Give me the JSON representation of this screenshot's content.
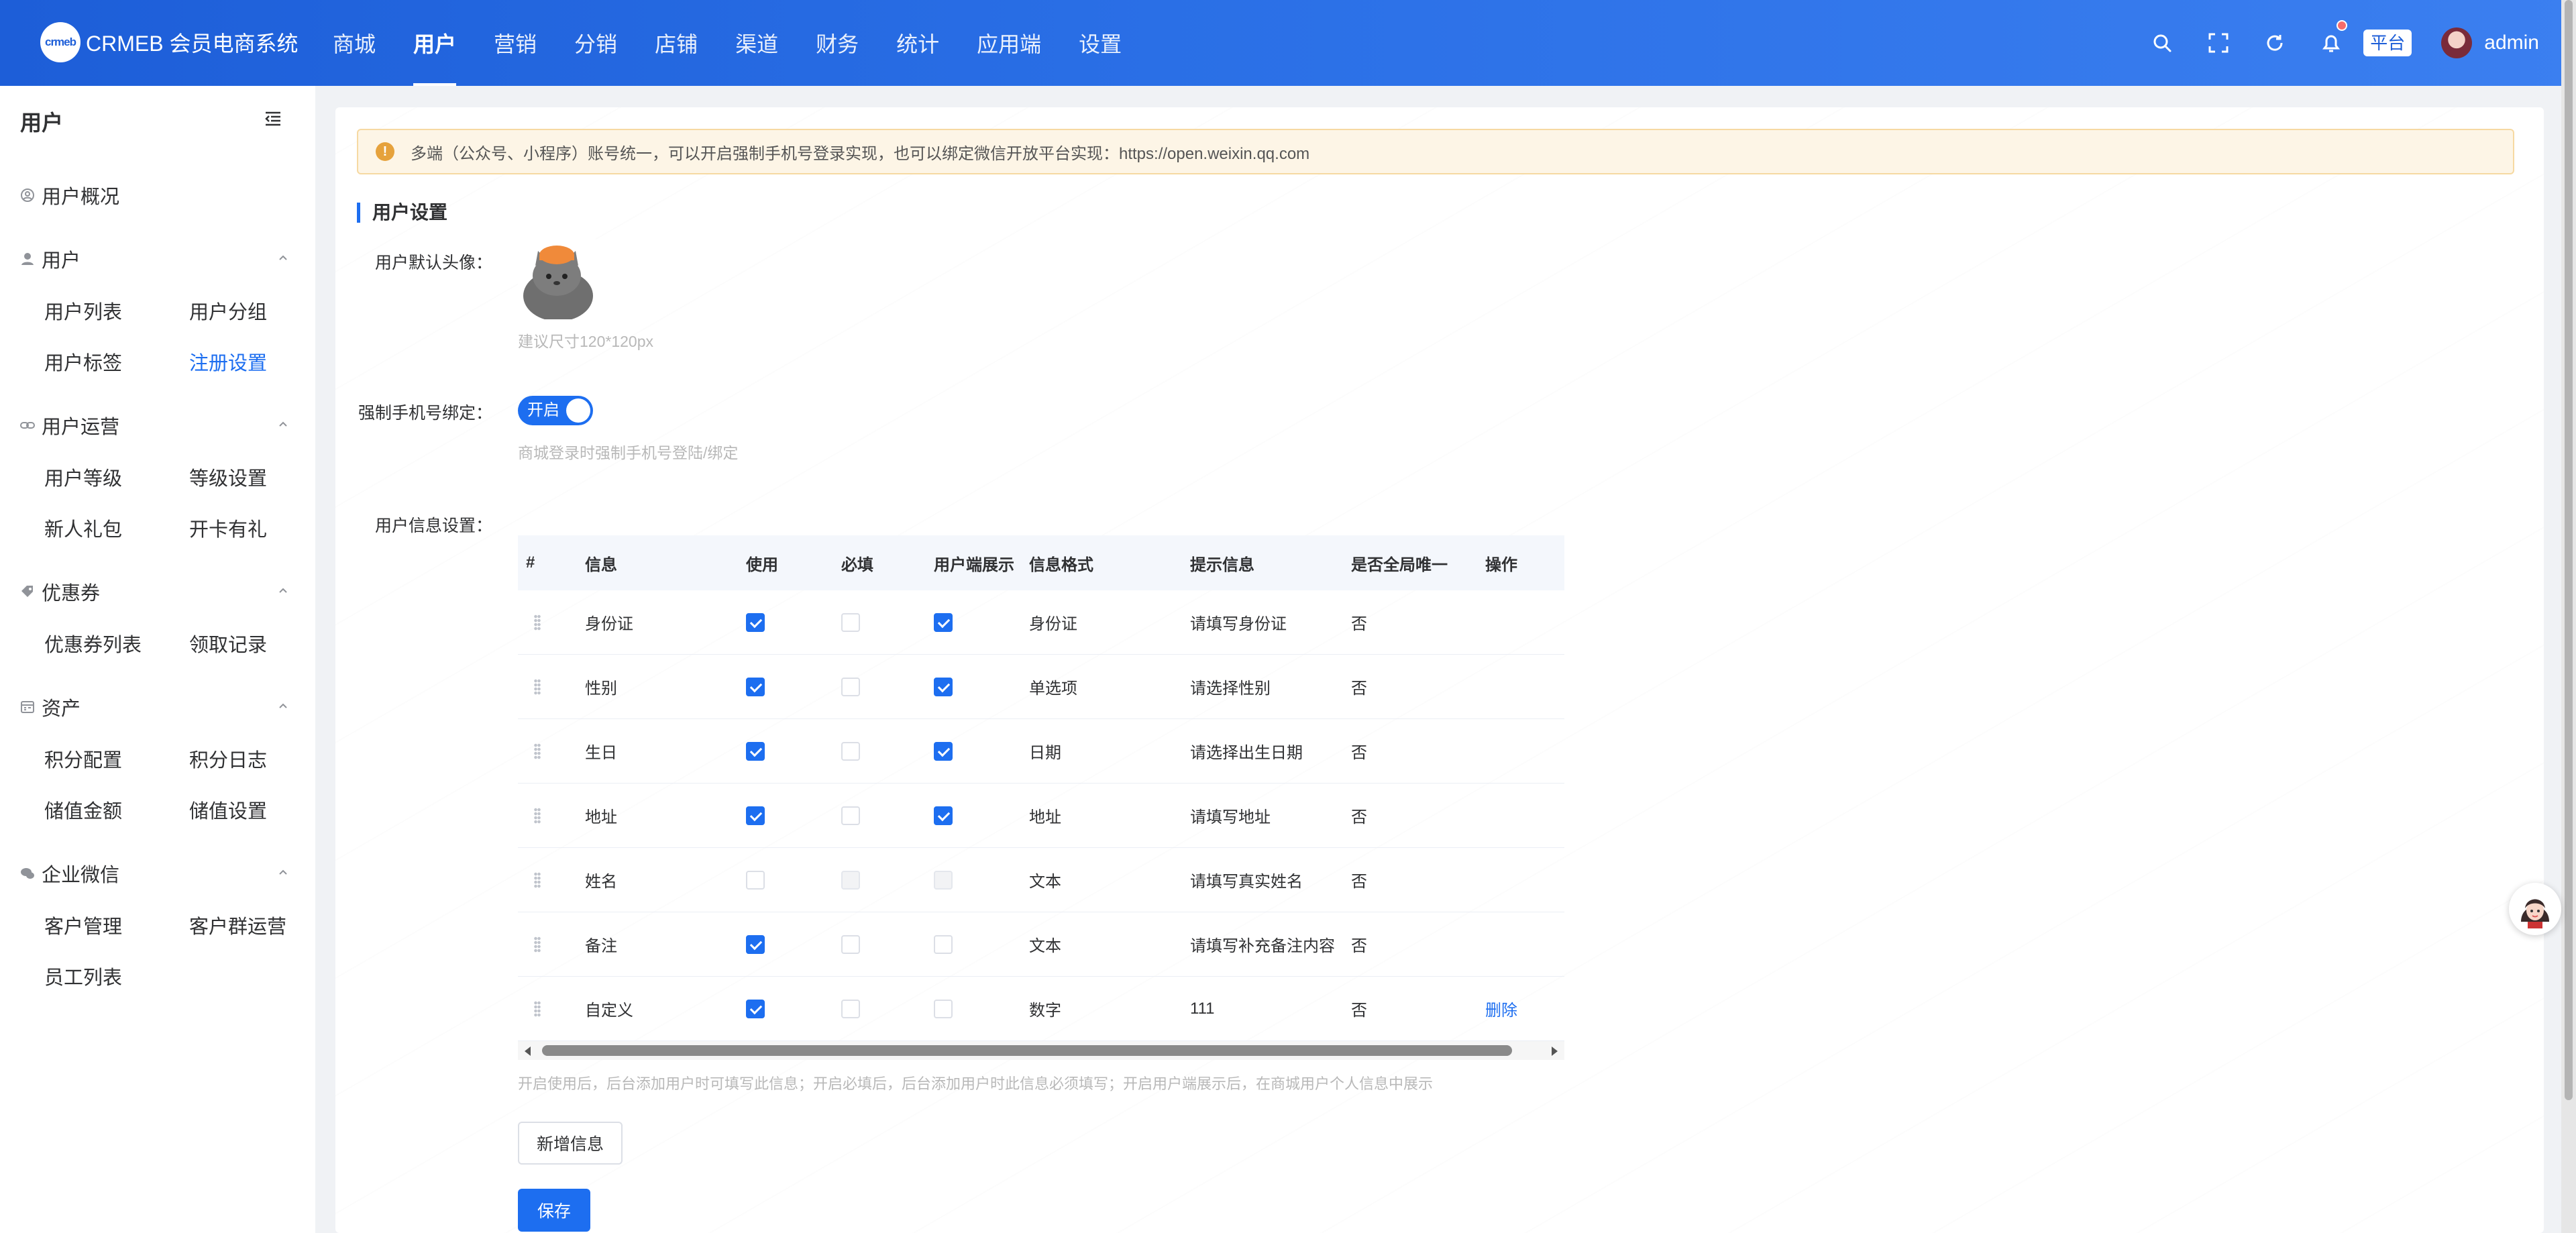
{
  "header": {
    "logo_mark": "crmeb",
    "logo_text": "CRMEB 会员电商系统",
    "nav": [
      "商城",
      "用户",
      "营销",
      "分销",
      "店铺",
      "渠道",
      "财务",
      "统计",
      "应用端",
      "设置"
    ],
    "nav_active_index": 1,
    "icons": [
      "search-icon",
      "fullscreen-icon",
      "refresh-icon",
      "bell-icon"
    ],
    "platform_tag": "平台",
    "username": "admin"
  },
  "sidebar": {
    "title": "用户",
    "groups": [
      {
        "label": "用户概况",
        "icon": "user-circle-icon",
        "items": []
      },
      {
        "label": "用户",
        "icon": "user-icon",
        "items": [
          "用户列表",
          "用户分组",
          "用户标签",
          "注册设置"
        ]
      },
      {
        "label": "用户运营",
        "icon": "link-icon",
        "items": [
          "用户等级",
          "等级设置",
          "新人礼包",
          "开卡有礼"
        ]
      },
      {
        "label": "优惠券",
        "icon": "ticket-icon",
        "items": [
          "优惠券列表",
          "领取记录"
        ]
      },
      {
        "label": "资产",
        "icon": "wallet-icon",
        "items": [
          "积分配置",
          "积分日志",
          "储值金额",
          "储值设置"
        ]
      },
      {
        "label": "企业微信",
        "icon": "wechat-icon",
        "items": [
          "客户管理",
          "客户群运营",
          "员工列表"
        ]
      }
    ],
    "active_item": "注册设置"
  },
  "main": {
    "notice": "多端（公众号、小程序）账号统一，可以开启强制手机号登录实现，也可以绑定微信开放平台实现：https://open.weixin.qq.com",
    "section_title": "用户设置",
    "avatar_label": "用户默认头像：",
    "avatar_hint": "建议尺寸120*120px",
    "phone_label": "强制手机号绑定：",
    "switch_text": "开启",
    "phone_hint": "商城登录时强制手机号登陆/绑定",
    "info_label": "用户信息设置：",
    "table": {
      "headers": [
        "#",
        "信息",
        "使用",
        "必填",
        "用户端展示",
        "信息格式",
        "提示信息",
        "是否全局唯一",
        "操作"
      ],
      "rows": [
        {
          "name": "身份证",
          "use": "on",
          "required": "off",
          "show": "on",
          "format": "身份证",
          "tip": "请填写身份证",
          "unique": "否",
          "action": ""
        },
        {
          "name": "性别",
          "use": "on",
          "required": "off",
          "show": "on",
          "format": "单选项",
          "tip": "请选择性别",
          "unique": "否",
          "action": ""
        },
        {
          "name": "生日",
          "use": "on",
          "required": "off",
          "show": "on",
          "format": "日期",
          "tip": "请选择出生日期",
          "unique": "否",
          "action": ""
        },
        {
          "name": "地址",
          "use": "on",
          "required": "off",
          "show": "on",
          "format": "地址",
          "tip": "请填写地址",
          "unique": "否",
          "action": ""
        },
        {
          "name": "姓名",
          "use": "off",
          "required": "dis",
          "show": "dis",
          "format": "文本",
          "tip": "请填写真实姓名",
          "unique": "否",
          "action": ""
        },
        {
          "name": "备注",
          "use": "on",
          "required": "off",
          "show": "off",
          "format": "文本",
          "tip": "请填写补充备注内容",
          "unique": "否",
          "action": ""
        },
        {
          "name": "自定义",
          "use": "on",
          "required": "off",
          "show": "off",
          "format": "数字",
          "tip": "111",
          "unique": "否",
          "action": "删除"
        }
      ]
    },
    "table_hint": "开启使用后，后台添加用户时可填写此信息；开启必填后，后台添加用户时此信息必须填写；开启用户端展示后，在商城用户个人信息中展示",
    "add_button": "新增信息",
    "save_button": "保存"
  },
  "colors": {
    "primary": "#1d6ef0",
    "header": "#2a6fe6",
    "notice_bg": "#fdf5e6"
  }
}
